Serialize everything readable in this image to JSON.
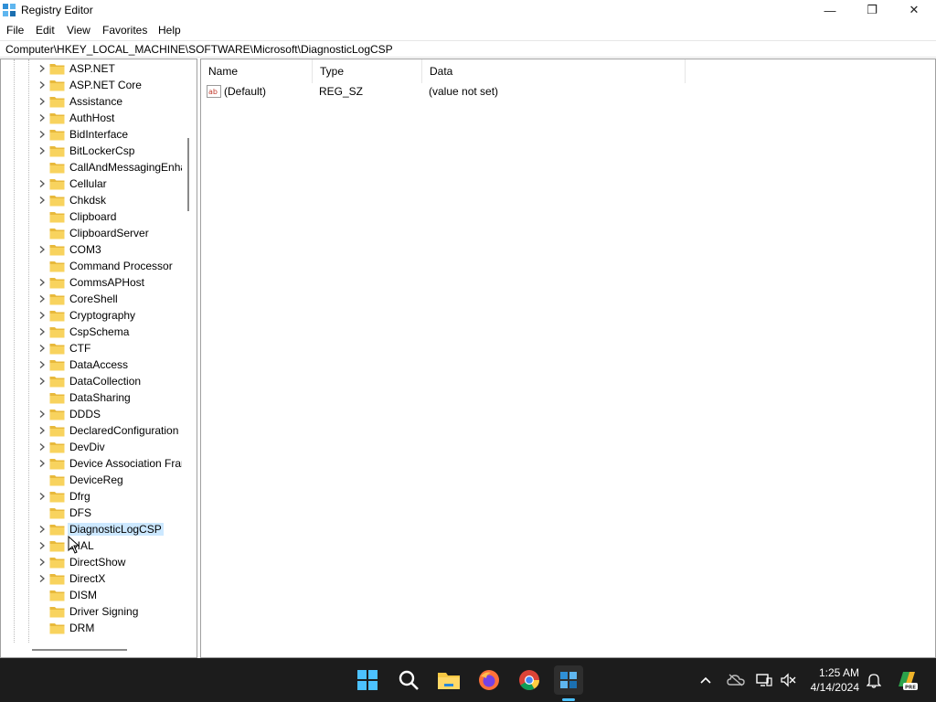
{
  "window": {
    "title": "Registry Editor",
    "minimize_glyph": "—",
    "maximize_glyph": "❐",
    "close_glyph": "✕"
  },
  "menu": [
    "File",
    "Edit",
    "View",
    "Favorites",
    "Help"
  ],
  "address": "Computer\\HKEY_LOCAL_MACHINE\\SOFTWARE\\Microsoft\\DiagnosticLogCSP",
  "tree": {
    "items": [
      {
        "label": "ASP.NET",
        "expandable": true
      },
      {
        "label": "ASP.NET Core",
        "expandable": true
      },
      {
        "label": "Assistance",
        "expandable": true
      },
      {
        "label": "AuthHost",
        "expandable": true
      },
      {
        "label": "BidInterface",
        "expandable": true
      },
      {
        "label": "BitLockerCsp",
        "expandable": true
      },
      {
        "label": "CallAndMessagingEnha",
        "expandable": false
      },
      {
        "label": "Cellular",
        "expandable": true
      },
      {
        "label": "Chkdsk",
        "expandable": true
      },
      {
        "label": "Clipboard",
        "expandable": false
      },
      {
        "label": "ClipboardServer",
        "expandable": false
      },
      {
        "label": "COM3",
        "expandable": true
      },
      {
        "label": "Command Processor",
        "expandable": false
      },
      {
        "label": "CommsAPHost",
        "expandable": true
      },
      {
        "label": "CoreShell",
        "expandable": true
      },
      {
        "label": "Cryptography",
        "expandable": true
      },
      {
        "label": "CspSchema",
        "expandable": true
      },
      {
        "label": "CTF",
        "expandable": true
      },
      {
        "label": "DataAccess",
        "expandable": true
      },
      {
        "label": "DataCollection",
        "expandable": true
      },
      {
        "label": "DataSharing",
        "expandable": false
      },
      {
        "label": "DDDS",
        "expandable": true
      },
      {
        "label": "DeclaredConfiguration",
        "expandable": true
      },
      {
        "label": "DevDiv",
        "expandable": true
      },
      {
        "label": "Device Association Fran",
        "expandable": true
      },
      {
        "label": "DeviceReg",
        "expandable": false
      },
      {
        "label": "Dfrg",
        "expandable": true
      },
      {
        "label": "DFS",
        "expandable": false
      },
      {
        "label": "DiagnosticLogCSP",
        "expandable": true,
        "selected": true
      },
      {
        "label": "DIAL",
        "expandable": true
      },
      {
        "label": "DirectShow",
        "expandable": true
      },
      {
        "label": "DirectX",
        "expandable": true
      },
      {
        "label": "DISM",
        "expandable": false
      },
      {
        "label": "Driver Signing",
        "expandable": false
      },
      {
        "label": "DRM",
        "expandable": false
      }
    ]
  },
  "values": {
    "columns": [
      "Name",
      "Type",
      "Data"
    ],
    "rows": [
      {
        "name": "(Default)",
        "type": "REG_SZ",
        "data": "(value not set)",
        "icon": "ab-string-icon"
      }
    ]
  },
  "taskbar": {
    "apps": [
      "start-icon",
      "search-icon",
      "file-explorer-icon",
      "firefox-icon",
      "chrome-icon",
      "registry-editor-icon"
    ],
    "time": "1:25 AM",
    "date": "4/14/2024",
    "badge": "PRE"
  }
}
